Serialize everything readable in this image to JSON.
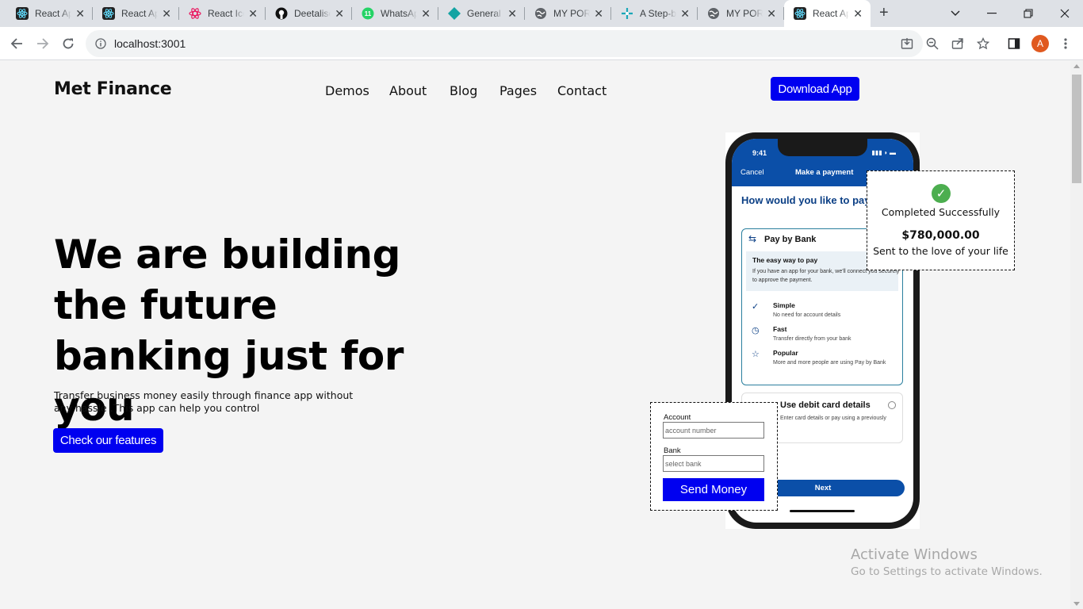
{
  "browser": {
    "tabs": [
      {
        "title": "React App",
        "icon": "react-icon"
      },
      {
        "title": "React App",
        "icon": "react-icon"
      },
      {
        "title": "React Icons",
        "icon": "react-icons-icon"
      },
      {
        "title": "Deetalise",
        "icon": "github-icon"
      },
      {
        "title": "WhatsApp",
        "icon": "whatsapp-icon"
      },
      {
        "title": "General",
        "icon": "diamond-icon"
      },
      {
        "title": "MY PORTFOLIO",
        "icon": "globe-icon"
      },
      {
        "title": "A Step-by",
        "icon": "plus-icon"
      },
      {
        "title": "MY PORTFOLIO",
        "icon": "globe-icon"
      },
      {
        "title": "React App",
        "icon": "react-icon"
      }
    ],
    "whatsapp_badge": "11",
    "url": "localhost:3001",
    "profile_initial": "A"
  },
  "site": {
    "brand": "Met Finance",
    "nav": [
      "Demos",
      "About",
      "Blog",
      "Pages",
      "Contact"
    ],
    "download_button": "Download App"
  },
  "hero": {
    "title": "We are building the future banking just for you",
    "subtitle": "Transfer business money easily through finance app without any hassle .This app can help you control",
    "cta": "Check our features"
  },
  "phone": {
    "time": "9:41",
    "cancel": "Cancel",
    "title": "Make a payment",
    "question": "How would you like to pay?",
    "pay_by_bank": "Pay by Bank",
    "easy_title": "The easy way to pay",
    "easy_text": "If you have an app for your bank, we'll connect you securely to approve the payment.",
    "features": [
      {
        "name": "Simple",
        "desc": "No need for account details"
      },
      {
        "name": "Fast",
        "desc": "Transfer directly from your bank"
      },
      {
        "name": "Popular",
        "desc": "More and more people are using Pay by Bank"
      }
    ],
    "card_title": "Use debit card details",
    "card_sub": "Enter card details or pay using a previously",
    "next": "Next"
  },
  "success_card": {
    "status": "Completed Successfully",
    "amount": "$780,000.00",
    "note": "Sent to the love of your life"
  },
  "send_form": {
    "account_label": "Account",
    "account_placeholder": "account number",
    "bank_label": "Bank",
    "bank_placeholder": "select bank",
    "submit": "Send Money"
  },
  "watermark": {
    "line1": "Activate Windows",
    "line2": "Go to Settings to activate Windows."
  },
  "colors": {
    "primary_button": "#0000f0",
    "app_blue": "#0b4fa8",
    "page_bg": "#f4f4f4",
    "success_green": "#4cae4f"
  }
}
